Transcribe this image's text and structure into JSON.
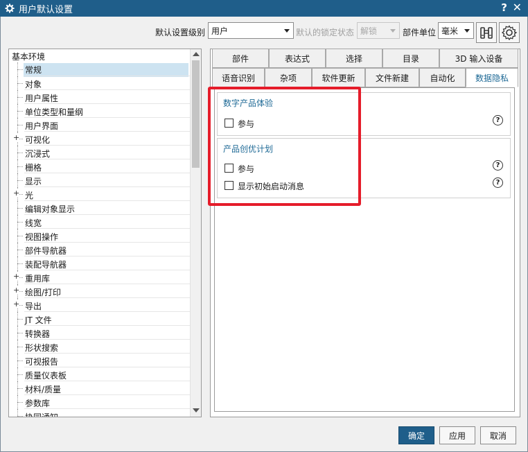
{
  "window": {
    "title": "用户默认设置",
    "help": "?",
    "close": "✕"
  },
  "toolbar": {
    "level_label": "默认设置级别",
    "level_value": "用户",
    "lock_label": "默认的锁定状态",
    "lock_value": "解锁",
    "unit_label": "部件单位",
    "unit_value": "毫米"
  },
  "tree": {
    "root": "基本环境",
    "items": [
      {
        "label": "常规",
        "expand": ""
      },
      {
        "label": "对象",
        "expand": ""
      },
      {
        "label": "用户属性",
        "expand": ""
      },
      {
        "label": "单位类型和量纲",
        "expand": ""
      },
      {
        "label": "用户界面",
        "expand": ""
      },
      {
        "label": "可视化",
        "expand": "+"
      },
      {
        "label": "沉浸式",
        "expand": ""
      },
      {
        "label": "栅格",
        "expand": ""
      },
      {
        "label": "显示",
        "expand": ""
      },
      {
        "label": "光",
        "expand": "+"
      },
      {
        "label": "编辑对象显示",
        "expand": ""
      },
      {
        "label": "线宽",
        "expand": ""
      },
      {
        "label": "视图操作",
        "expand": ""
      },
      {
        "label": "部件导航器",
        "expand": ""
      },
      {
        "label": "装配导航器",
        "expand": ""
      },
      {
        "label": "重用库",
        "expand": "+"
      },
      {
        "label": "绘图/打印",
        "expand": "+"
      },
      {
        "label": "导出",
        "expand": "+"
      },
      {
        "label": "JT 文件",
        "expand": ""
      },
      {
        "label": "转换器",
        "expand": ""
      },
      {
        "label": "形状搜索",
        "expand": ""
      },
      {
        "label": "可视报告",
        "expand": ""
      },
      {
        "label": "质量仪表板",
        "expand": ""
      },
      {
        "label": "材料/质量",
        "expand": ""
      },
      {
        "label": "参数库",
        "expand": ""
      },
      {
        "label": "协同通知",
        "expand": ""
      }
    ]
  },
  "tabs_row1": [
    "部件",
    "表达式",
    "选择",
    "目录",
    "3D 输入设备"
  ],
  "tabs_row2": [
    "语音识别",
    "杂项",
    "软件更新",
    "文件新建",
    "自动化",
    "数据隐私"
  ],
  "groups": [
    {
      "title": "数字产品体验",
      "options": [
        "参与"
      ]
    },
    {
      "title": "产品创优计划",
      "options": [
        "参与",
        "显示初始启动消息"
      ]
    }
  ],
  "buttons": {
    "ok": "确定",
    "apply": "应用",
    "cancel": "取消"
  },
  "colors": {
    "titlebar": "#1f5e8a",
    "accent": "#1f6a96",
    "highlight": "#e51c2a"
  }
}
